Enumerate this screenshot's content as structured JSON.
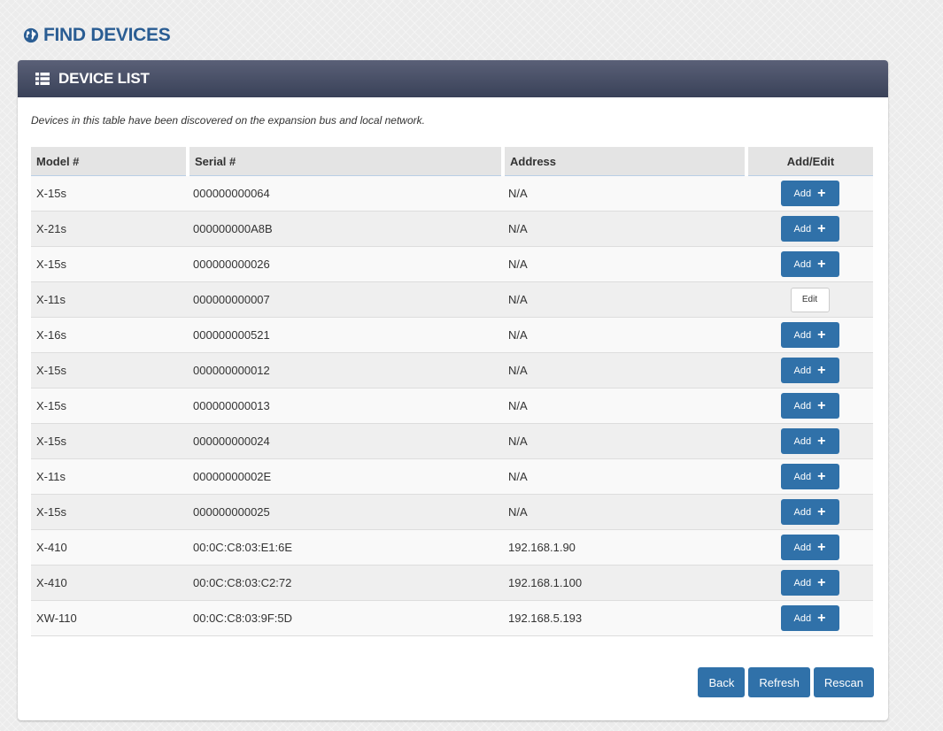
{
  "page": {
    "title": "FIND DEVICES"
  },
  "panel": {
    "title": "DEVICE LIST",
    "description": "Devices in this table have been discovered on the expansion bus and local network."
  },
  "table": {
    "columns": [
      "Model #",
      "Serial #",
      "Address",
      "Add/Edit"
    ],
    "rows": [
      {
        "model": "X-15s",
        "serial": "000000000064",
        "address": "N/A",
        "action": "Add"
      },
      {
        "model": "X-21s",
        "serial": "000000000A8B",
        "address": "N/A",
        "action": "Add"
      },
      {
        "model": "X-15s",
        "serial": "000000000026",
        "address": "N/A",
        "action": "Add"
      },
      {
        "model": "X-11s",
        "serial": "000000000007",
        "address": "N/A",
        "action": "Edit"
      },
      {
        "model": "X-16s",
        "serial": "000000000521",
        "address": "N/A",
        "action": "Add"
      },
      {
        "model": "X-15s",
        "serial": "000000000012",
        "address": "N/A",
        "action": "Add"
      },
      {
        "model": "X-15s",
        "serial": "000000000013",
        "address": "N/A",
        "action": "Add"
      },
      {
        "model": "X-15s",
        "serial": "000000000024",
        "address": "N/A",
        "action": "Add"
      },
      {
        "model": "X-11s",
        "serial": "00000000002E",
        "address": "N/A",
        "action": "Add"
      },
      {
        "model": "X-15s",
        "serial": "000000000025",
        "address": "N/A",
        "action": "Add"
      },
      {
        "model": "X-410",
        "serial": "00:0C:C8:03:E1:6E",
        "address": "192.168.1.90",
        "action": "Add"
      },
      {
        "model": "X-410",
        "serial": "00:0C:C8:03:C2:72",
        "address": "192.168.1.100",
        "action": "Add"
      },
      {
        "model": "XW-110",
        "serial": "00:0C:C8:03:9F:5D",
        "address": "192.168.5.193",
        "action": "Add"
      }
    ]
  },
  "footer": {
    "back_label": "Back",
    "refresh_label": "Refresh",
    "rescan_label": "Rescan"
  },
  "icons": {
    "title_icon": "globe-icon",
    "panel_icon": "list-icon",
    "add_icon": "plus-icon"
  },
  "colors": {
    "title": "#2a5d93",
    "primary_button": "#3071a9",
    "panel_header": "#394158"
  }
}
